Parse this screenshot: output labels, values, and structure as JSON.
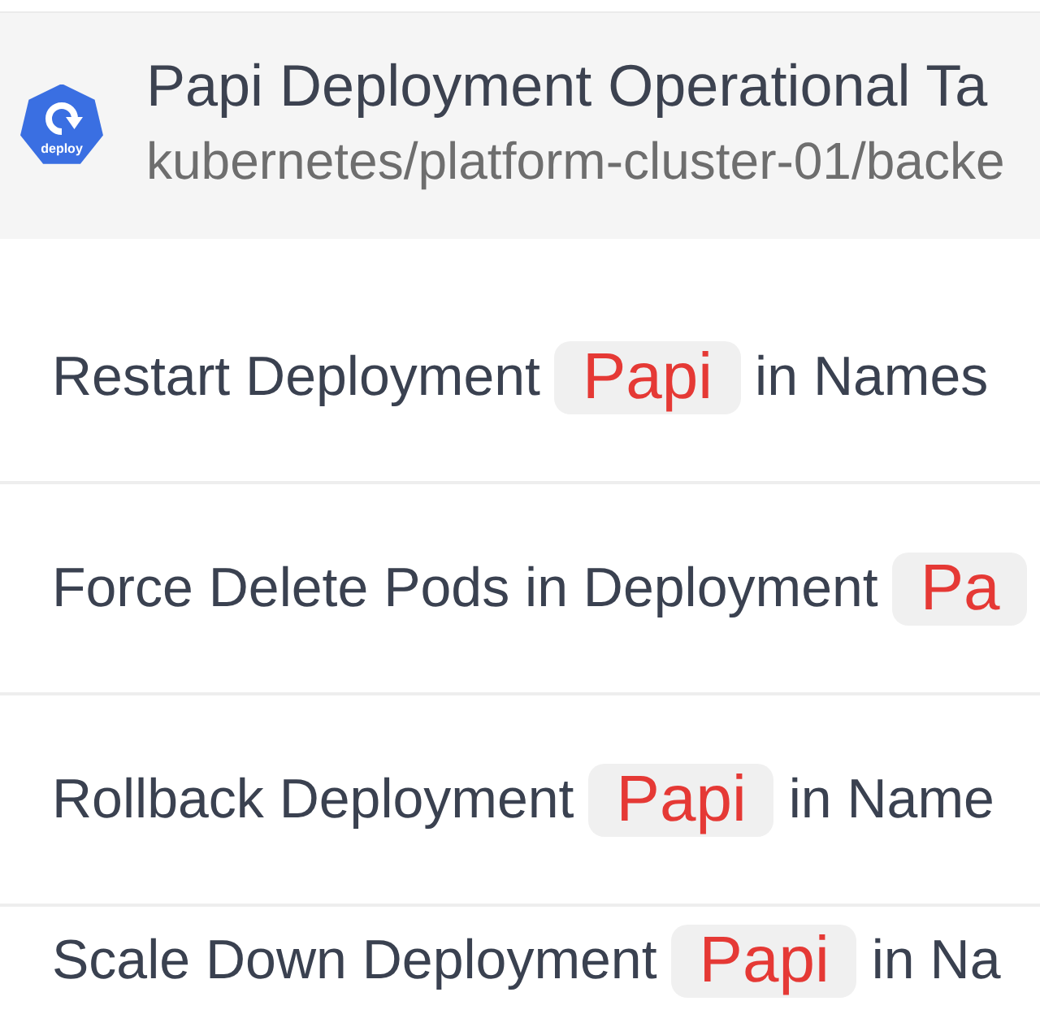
{
  "header": {
    "icon_label": "deploy",
    "title": "Papi Deployment Operational Ta",
    "path": "kubernetes/platform-cluster-01/backe"
  },
  "tasks": [
    {
      "action": "Restart Deployment",
      "target": "Papi",
      "suffix": "in Names"
    },
    {
      "action": "Force Delete Pods in Deployment",
      "target": "Pa"
    },
    {
      "action": "Rollback Deployment",
      "target": "Papi",
      "suffix": "in Name"
    },
    {
      "action": "Scale Down Deployment",
      "target": "Papi",
      "suffix": "in Na"
    }
  ]
}
